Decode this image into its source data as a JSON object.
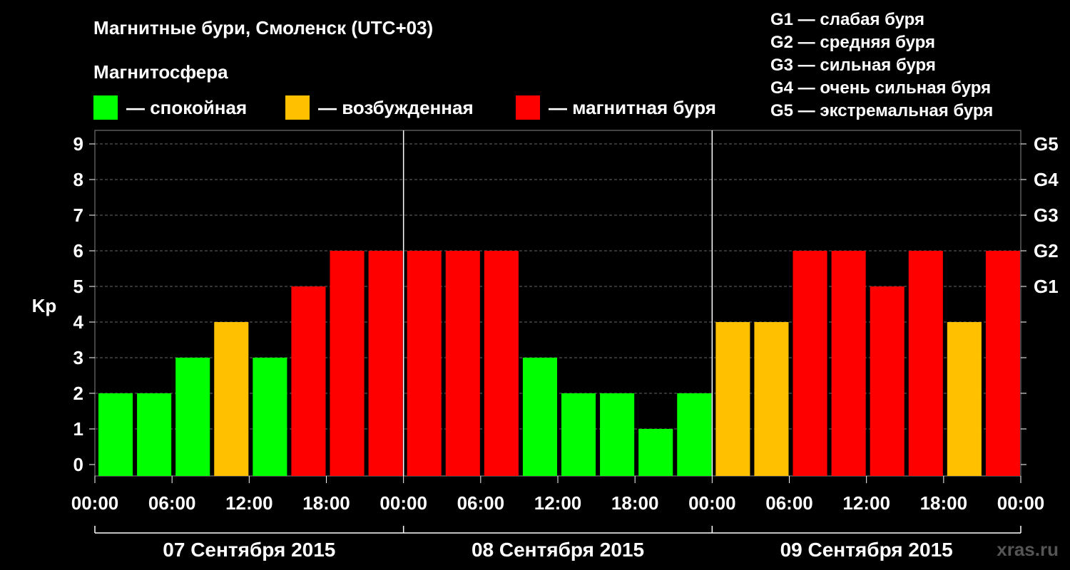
{
  "header": {
    "title": "Магнитные бури, Смоленск (UTC+03)",
    "subtitle": "Магнитосфера"
  },
  "legend": {
    "items": [
      {
        "label": "— спокойная",
        "color": "#00ff00"
      },
      {
        "label": "— возбужденная",
        "color": "#ffc000"
      },
      {
        "label": "— магнитная буря",
        "color": "#ff0000"
      }
    ]
  },
  "g_legend": [
    "G1 — слабая буря",
    "G2 — средняя буря",
    "G3 — сильная буря",
    "G4 — очень сильная буря",
    "G5 — экстремальная буря"
  ],
  "watermark": "xras.ru",
  "chart_data": {
    "type": "bar",
    "ylabel": "Kp",
    "ylim": [
      0,
      9
    ],
    "yticks": [
      0,
      1,
      2,
      3,
      4,
      5,
      6,
      7,
      8,
      9
    ],
    "right_ticks": [
      {
        "value": 5,
        "label": "G1"
      },
      {
        "value": 6,
        "label": "G2"
      },
      {
        "value": 7,
        "label": "G3"
      },
      {
        "value": 8,
        "label": "G4"
      },
      {
        "value": 9,
        "label": "G5"
      }
    ],
    "grid": true,
    "x_tick_labels": [
      "00:00",
      "06:00",
      "12:00",
      "18:00",
      "00:00",
      "06:00",
      "12:00",
      "18:00",
      "00:00",
      "06:00",
      "12:00",
      "18:00",
      "00:00"
    ],
    "days": [
      "07 Сентября 2015",
      "08 Сентября 2015",
      "09 Сентября 2015"
    ],
    "values": [
      2,
      2,
      3,
      4,
      3,
      5,
      6,
      6,
      6,
      6,
      6,
      3,
      2,
      2,
      1,
      2,
      4,
      4,
      6,
      6,
      5,
      6,
      4,
      6
    ],
    "colors": {
      "quiet": "#00ff00",
      "disturbed": "#ffc000",
      "storm": "#ff0000"
    }
  }
}
